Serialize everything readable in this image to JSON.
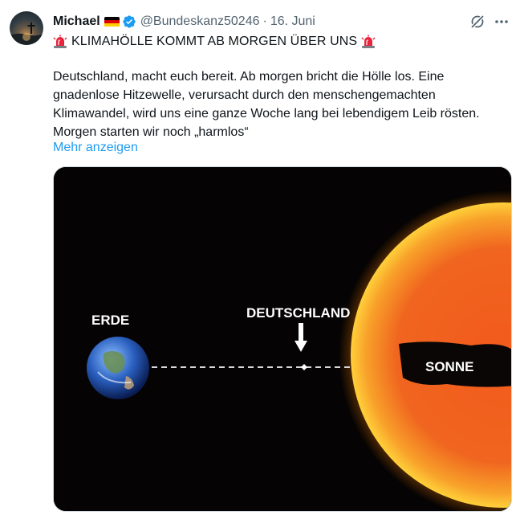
{
  "tweet": {
    "author_name": "Michael",
    "handle": "@Bundeskanz50246",
    "separator": "·",
    "date": "16. Juni",
    "title": "KLIMAHÖLLE KOMMT AB MORGEN ÜBER UNS",
    "body_lines": [
      "Deutschland, macht euch bereit. Ab morgen bricht die Hölle los. Eine",
      "gnadenlose Hitzewelle, verursacht durch den menschengemachten",
      "Klimawandel, wird uns eine ganze Woche lang bei lebendigem Leib rösten.",
      "Morgen starten wir noch „harmlos“"
    ],
    "show_more": "Mehr anzeigen"
  },
  "media": {
    "label_earth": "ERDE",
    "label_germany": "DEUTSCHLAND",
    "label_sun": "SONNE"
  },
  "icons": {
    "flag": "germany-flag-icon",
    "verified": "verified-badge-icon",
    "grok": "grok-icon",
    "more": "more-icon",
    "siren": "rotating-light-icon"
  },
  "colors": {
    "link": "#1d9bf0",
    "verified": "#1d9bf0",
    "secondary_text": "#536471"
  }
}
